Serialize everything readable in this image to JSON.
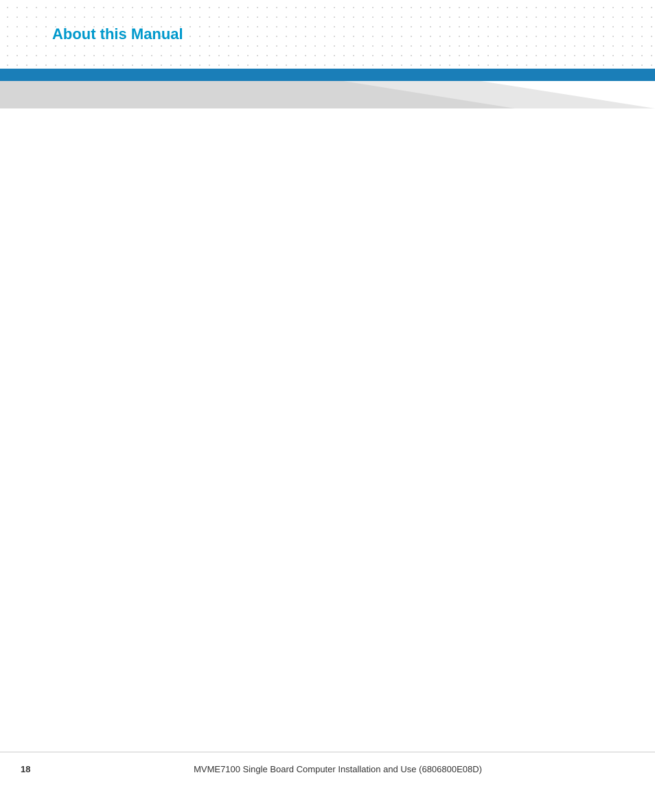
{
  "header": {
    "title": "About this Manual"
  },
  "footer": {
    "page_number": "18",
    "document_title": "MVME7100 Single Board Computer Installation and Use (6806800E08D)"
  },
  "colors": {
    "title_blue": "#0099cc",
    "bar_blue": "#1a7eb8",
    "dot_color": "#c8c8c8",
    "diagonal_light": "#d0d0d0",
    "diagonal_lighter": "#e8e8e8"
  }
}
